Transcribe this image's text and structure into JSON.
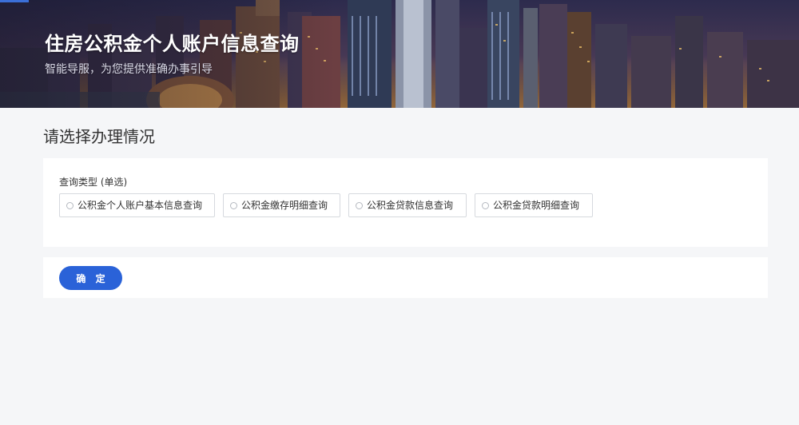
{
  "banner": {
    "title": "住房公积金个人账户信息查询",
    "subtitle": "智能导服，为您提供准确办事引导"
  },
  "main": {
    "heading": "请选择办理情况",
    "query_type": {
      "label": "查询类型 (单选)",
      "options": [
        {
          "label": "公积金个人账户基本信息查询",
          "selected": false
        },
        {
          "label": "公积金缴存明细查询",
          "selected": false
        },
        {
          "label": "公积金贷款信息查询",
          "selected": false
        },
        {
          "label": "公积金贷款明细查询",
          "selected": false
        }
      ]
    },
    "confirm_label": "确 定"
  },
  "colors": {
    "accent": "#2a62d8",
    "page_background": "#f5f6f8",
    "card_background": "#ffffff",
    "option_border": "#d6d9de",
    "text": "#333333"
  }
}
